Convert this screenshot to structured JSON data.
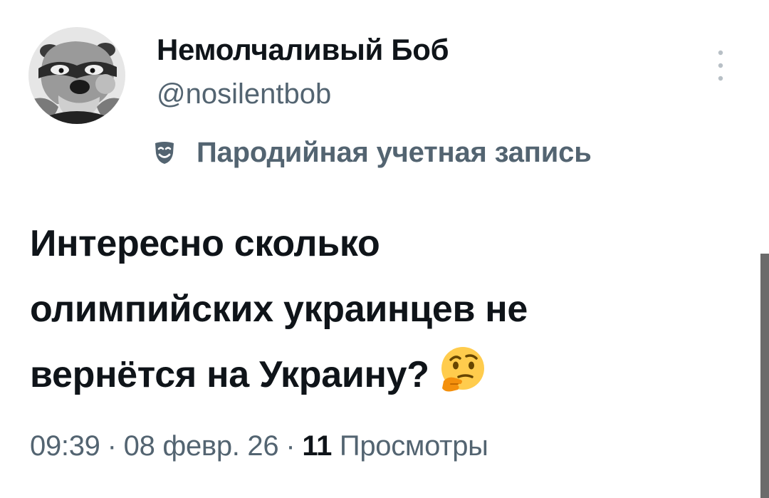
{
  "author": {
    "display_name": "Немолчаливый Боб",
    "handle": "@nosilentbob",
    "avatar_icon": "cartoon-meerkat-avatar",
    "parody_icon": "theater-mask-icon",
    "parody_label": "Пародийная учетная запись"
  },
  "tweet": {
    "lines": [
      "Интересно сколько",
      "олимпийских украинцев не",
      "вернётся на Украину?"
    ],
    "emoji": "thinking-face-emoji"
  },
  "meta": {
    "time": "09:39",
    "separator": "·",
    "date": "08 февр. 26",
    "views_count": "11",
    "views_label": "Просмотры"
  },
  "colors": {
    "text_primary": "#0f1419",
    "text_secondary": "#536471",
    "background": "#ffffff"
  }
}
